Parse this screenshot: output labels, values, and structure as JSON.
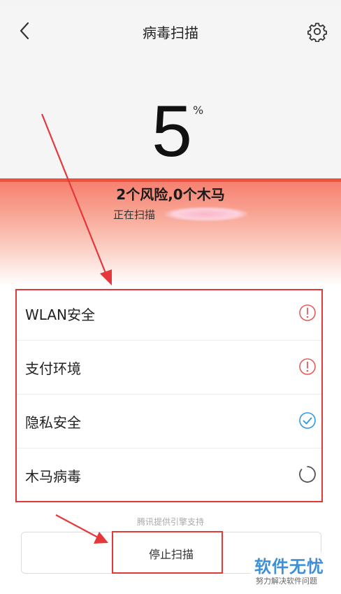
{
  "header": {
    "title": "病毒扫描"
  },
  "progress": {
    "value": "5",
    "unit": "%",
    "fraction": 0.05
  },
  "summary": {
    "risk_text": "2个风险,0个木马",
    "scanning_text": "正在扫描"
  },
  "scan_items": [
    {
      "label": "WLAN安全",
      "status": "warning",
      "icon": "warning-icon"
    },
    {
      "label": "支付环境",
      "status": "warning",
      "icon": "warning-icon"
    },
    {
      "label": "隐私安全",
      "status": "safe",
      "icon": "check-circle-icon"
    },
    {
      "label": "木马病毒",
      "status": "scanning",
      "icon": "spinner-icon"
    }
  ],
  "footer": {
    "engine_note": "腾讯提供引擎支持",
    "stop_label": "停止扫描"
  },
  "watermark": {
    "title": "软件无忧",
    "subtitle": "努力解决软件问题"
  },
  "colors": {
    "warning": "#e8595a",
    "safe": "#2f9ae0",
    "scanning": "#555555",
    "progress_bar": "#f0513a",
    "annotation": "#e5383b"
  }
}
